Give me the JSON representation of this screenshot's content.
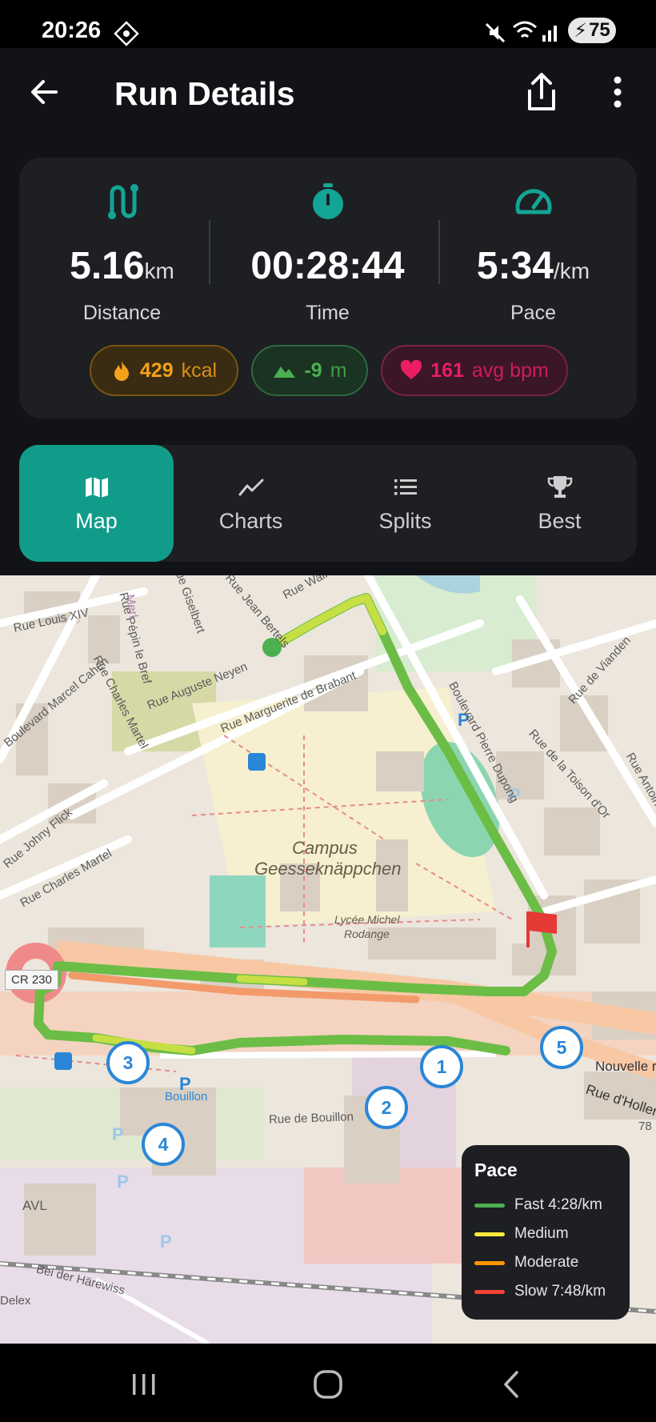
{
  "status_bar": {
    "time": "20:26",
    "battery": "75"
  },
  "appbar": {
    "title": "Run Details"
  },
  "stats": {
    "distance": {
      "value": "5.16",
      "unit": "km",
      "label": "Distance"
    },
    "time": {
      "value": "00:28:44",
      "unit": "",
      "label": "Time"
    },
    "pace": {
      "value": "5:34",
      "unit": "/km",
      "label": "Pace"
    }
  },
  "chips": {
    "calories": {
      "value": "429",
      "unit": "kcal"
    },
    "elevation": {
      "value": "-9",
      "unit": "m"
    },
    "heart_rate": {
      "value": "161",
      "unit": "avg bpm"
    }
  },
  "tabs": [
    {
      "label": "Map",
      "icon": "map-icon",
      "active": true
    },
    {
      "label": "Charts",
      "icon": "chart-line-icon",
      "active": false
    },
    {
      "label": "Splits",
      "icon": "list-icon",
      "active": false
    },
    {
      "label": "Best",
      "icon": "trophy-icon",
      "active": false
    }
  ],
  "map": {
    "labels": {
      "campus": "Campus",
      "campus2": "Geesseknäppchen",
      "lycee": "Lycée Michel",
      "lycee2": "Rodange",
      "cr230": "CR 230",
      "rue_louis": "Rue Louis XIV",
      "rue_auguste": "Rue Auguste Neyen",
      "rue_marguerite": "Rue Marguerite de Brabant",
      "rue_charles": "Rue Charles Martel",
      "rue_charles2": "Rue Charles Martel",
      "rue_johny": "Rue Johny Flick",
      "bd_pierre": "Boulevard Pierre Dupong",
      "rue_vianden": "Rue de Vianden",
      "rue_toison": "Rue de la Toison d'Or",
      "rue_bouillon": "Rue de Bouillon",
      "bouillon": "Bouillon",
      "nouvelle": "Nouvelle ro",
      "hollerich": "Rue d'Hollerich",
      "harewiss": "Bei der Härewiss",
      "avl": "AVL",
      "rue_walram": "Rue Walram",
      "rue_gisel": "Rue Giselbert",
      "rue_pepin": "Rue Pépin le Bref",
      "rue_jean": "Rue Jean Bertels",
      "rue_antoine": "Rue Antoine",
      "mer": "Merl",
      "num78": "78",
      "delex": "Delex",
      "evard": "Boulevard Marcel Cahen"
    },
    "km_markers": [
      "1",
      "2",
      "3",
      "4",
      "5"
    ],
    "legend": {
      "title": "Pace",
      "items": [
        {
          "label": "Fast 4:28/km",
          "color": "#4caf50"
        },
        {
          "label": "Medium",
          "color": "#ffeb3b"
        },
        {
          "label": "Moderate",
          "color": "#ff9800"
        },
        {
          "label": "Slow 7:48/km",
          "color": "#f44336"
        }
      ]
    }
  },
  "colors": {
    "accent": "#119c8a",
    "calories": "#f4a21a",
    "elevation": "#4caf50",
    "heart": "#e91e63"
  }
}
